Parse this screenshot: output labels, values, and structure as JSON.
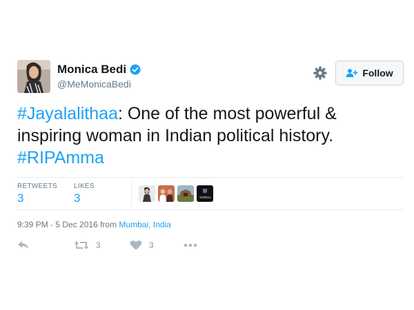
{
  "user": {
    "name": "Monica Bedi",
    "handle": "@MeMonicaBedi",
    "verified": true,
    "avatar_icon": "avatar-photo"
  },
  "header": {
    "gear_icon": "gear-icon",
    "follow_label": "Follow",
    "follow_icon": "person-add-icon"
  },
  "tweet": {
    "hashtag1": "#Jayalalithaa",
    "body": ": One of the most powerful & inspiring woman in Indian political history.",
    "hashtag2": "#RIPAmma"
  },
  "stats": {
    "retweets_label": "RETWEETS",
    "retweets_value": "3",
    "likes_label": "LIKES",
    "likes_value": "3",
    "liker_badge_text": "YUVRAJ"
  },
  "meta": {
    "timestamp": "9:39 PM - 5 Dec 2016",
    "from_text": " from ",
    "location": "Mumbai, India"
  },
  "actions": {
    "reply_icon": "reply-icon",
    "retweet_icon": "retweet-icon",
    "retweet_count": "3",
    "like_icon": "heart-icon",
    "like_count": "3",
    "more_icon": "more-icon"
  },
  "colors": {
    "link_blue": "#1da1f2",
    "verified_blue": "#1da1f2",
    "muted_gray": "#657786",
    "text_dark": "#14171a"
  }
}
